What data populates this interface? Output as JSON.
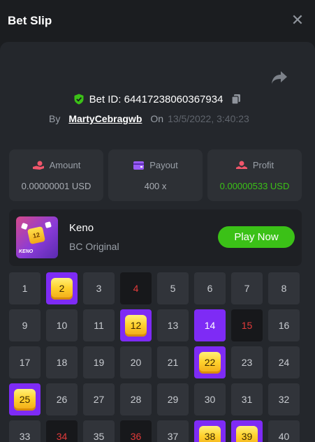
{
  "header": {
    "title": "Bet Slip",
    "close_icon": "close-icon"
  },
  "bet": {
    "id_text": "Bet ID: 64417238060367934",
    "by_label": "By",
    "user": "MartyCebragwb",
    "on_label": "On",
    "date": "13/5/2022, 3:40:23"
  },
  "stats": {
    "amount": {
      "label": "Amount",
      "value": "0.00000001 USD",
      "icon": "amount-icon"
    },
    "payout": {
      "label": "Payout",
      "value": "400 x",
      "icon": "wallet-icon"
    },
    "profit": {
      "label": "Profit",
      "value": "0.00000533 USD",
      "icon": "profit-icon",
      "color": "#3bc117"
    }
  },
  "game": {
    "name": "Keno",
    "subtitle": "BC Original",
    "play_label": "Play Now",
    "thumb_number": "12",
    "thumb_label": "KENO"
  },
  "colors": {
    "accent": "#7e2bf5",
    "green": "#3bc117",
    "miss": "#e23a3a"
  },
  "grid": {
    "cells": [
      {
        "n": "1",
        "state": "normal"
      },
      {
        "n": "2",
        "state": "hitgem"
      },
      {
        "n": "3",
        "state": "normal"
      },
      {
        "n": "4",
        "state": "miss"
      },
      {
        "n": "5",
        "state": "normal"
      },
      {
        "n": "6",
        "state": "normal"
      },
      {
        "n": "7",
        "state": "normal"
      },
      {
        "n": "8",
        "state": "normal"
      },
      {
        "n": "9",
        "state": "normal"
      },
      {
        "n": "10",
        "state": "normal"
      },
      {
        "n": "11",
        "state": "normal"
      },
      {
        "n": "12",
        "state": "hitgem"
      },
      {
        "n": "13",
        "state": "normal"
      },
      {
        "n": "14",
        "state": "hit"
      },
      {
        "n": "15",
        "state": "miss"
      },
      {
        "n": "16",
        "state": "normal"
      },
      {
        "n": "17",
        "state": "normal"
      },
      {
        "n": "18",
        "state": "normal"
      },
      {
        "n": "19",
        "state": "normal"
      },
      {
        "n": "20",
        "state": "normal"
      },
      {
        "n": "21",
        "state": "normal"
      },
      {
        "n": "22",
        "state": "hitgem"
      },
      {
        "n": "23",
        "state": "normal"
      },
      {
        "n": "24",
        "state": "normal"
      },
      {
        "n": "25",
        "state": "hitgem"
      },
      {
        "n": "26",
        "state": "normal"
      },
      {
        "n": "27",
        "state": "normal"
      },
      {
        "n": "28",
        "state": "normal"
      },
      {
        "n": "29",
        "state": "normal"
      },
      {
        "n": "30",
        "state": "normal"
      },
      {
        "n": "31",
        "state": "normal"
      },
      {
        "n": "32",
        "state": "normal"
      },
      {
        "n": "33",
        "state": "normal"
      },
      {
        "n": "34",
        "state": "miss"
      },
      {
        "n": "35",
        "state": "normal"
      },
      {
        "n": "36",
        "state": "miss"
      },
      {
        "n": "37",
        "state": "normal"
      },
      {
        "n": "38",
        "state": "hitgem"
      },
      {
        "n": "39",
        "state": "hitgem"
      },
      {
        "n": "40",
        "state": "normal"
      }
    ]
  }
}
